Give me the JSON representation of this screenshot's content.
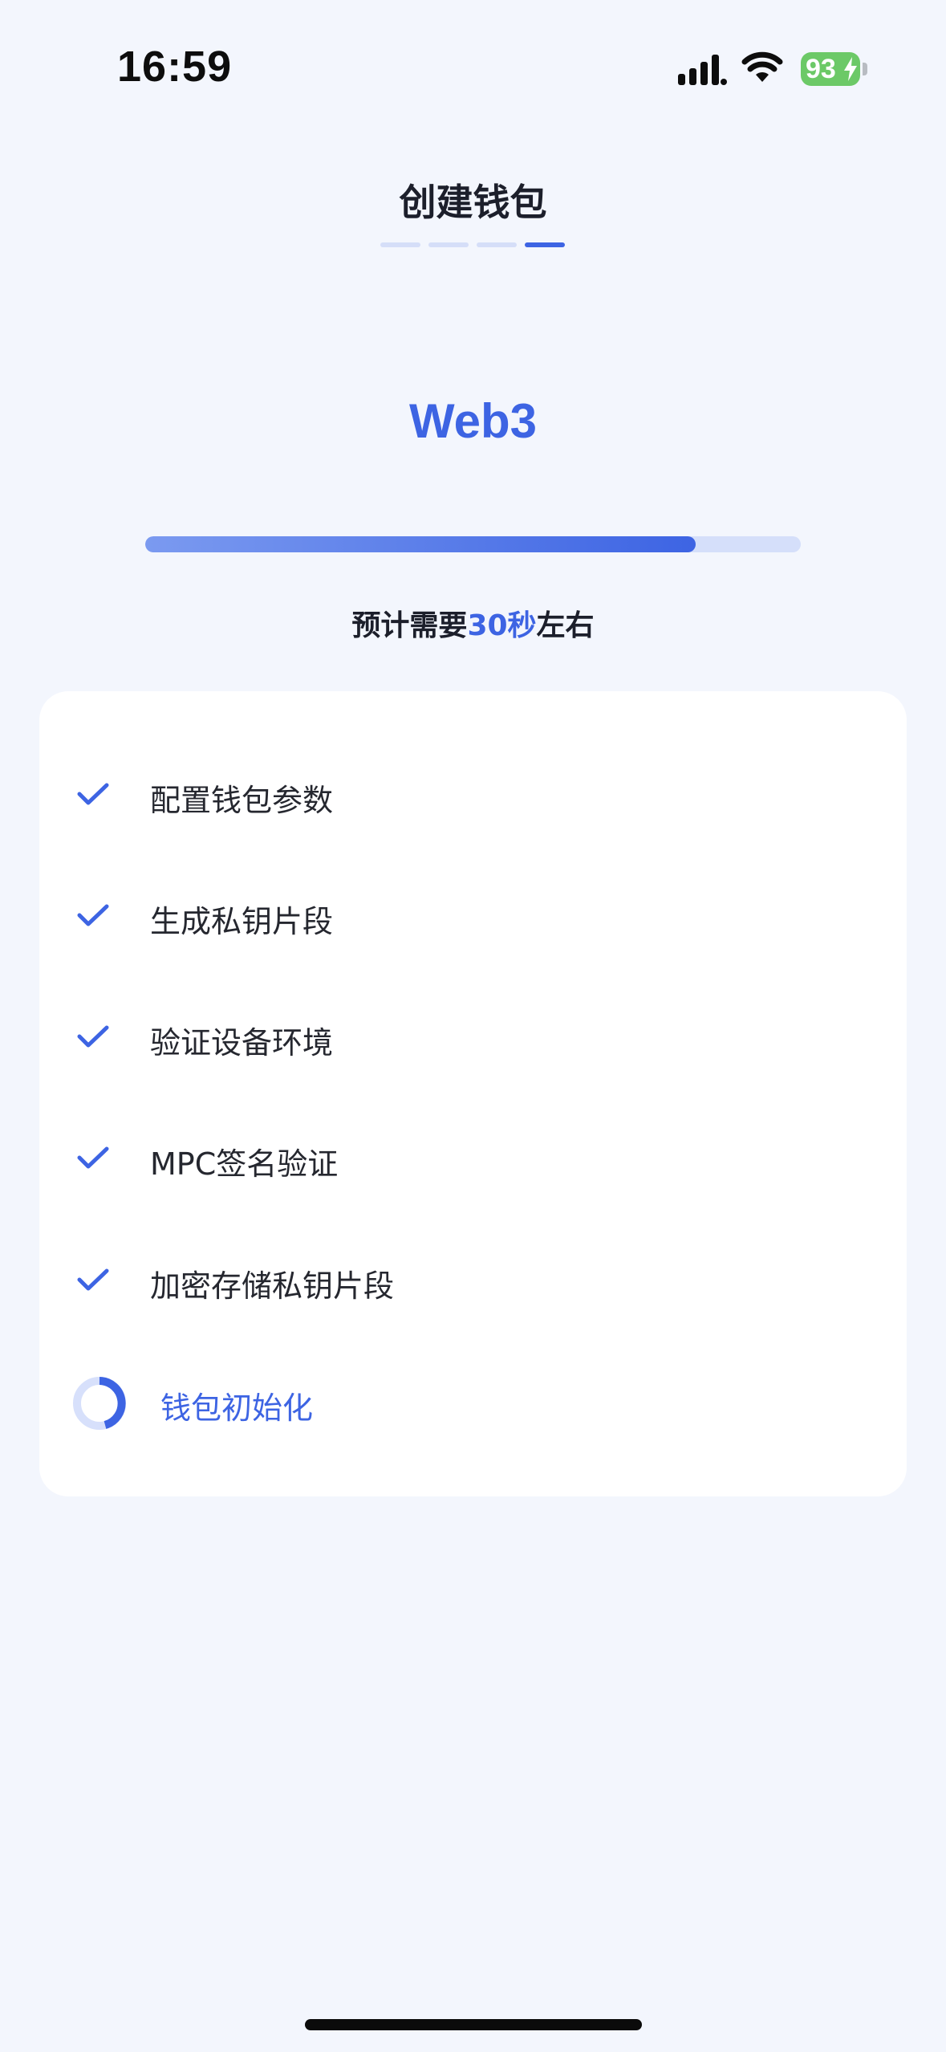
{
  "status_bar": {
    "time": "16:59",
    "battery_level": "93",
    "signal_icon": "cellular-signal-icon",
    "wifi_icon": "wifi-icon",
    "charging_icon": "bolt-icon"
  },
  "header": {
    "title": "创建钱包",
    "steps_total": 4,
    "steps_current": 4
  },
  "brand": {
    "title": "Web3"
  },
  "progress": {
    "fraction": 0.84,
    "estimate_prefix": "预计需要",
    "estimate_value": "30秒",
    "estimate_suffix": "左右"
  },
  "steps": [
    {
      "label": "配置钱包参数",
      "status": "done"
    },
    {
      "label": "生成私钥片段",
      "status": "done"
    },
    {
      "label": "验证设备环境",
      "status": "done"
    },
    {
      "label": "MPC签名验证",
      "status": "done"
    },
    {
      "label": "加密存储私钥片段",
      "status": "done"
    },
    {
      "label": "钱包初始化",
      "status": "in-progress"
    }
  ],
  "colors": {
    "accent": "#3d64e3",
    "background": "#f3f6fd",
    "card": "#ffffff",
    "battery": "#6cc967"
  }
}
